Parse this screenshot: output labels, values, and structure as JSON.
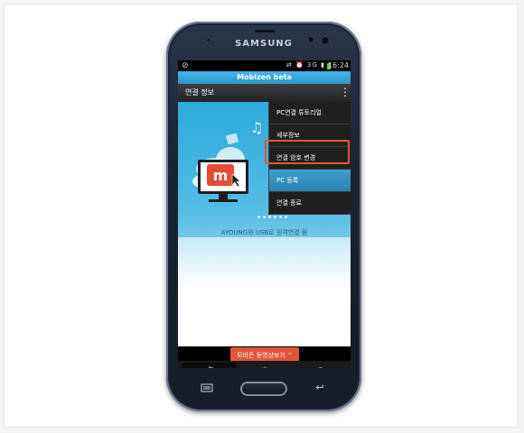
{
  "device": {
    "brand": "SAMSUNG"
  },
  "statusbar": {
    "time": "16:24",
    "network": "3G"
  },
  "app": {
    "title": "Mobizen beta"
  },
  "header": {
    "title": "연결 정보"
  },
  "menu": {
    "items": [
      {
        "label": "PC연결 튜토리얼",
        "selected": false
      },
      {
        "label": "세부정보",
        "selected": false
      },
      {
        "label": "연결 암호 변경",
        "selected": false
      },
      {
        "label": "PC 등록",
        "selected": true
      },
      {
        "label": "연결 종료",
        "selected": false
      }
    ]
  },
  "main": {
    "caption": "AYOUNG와 USB로 원격연결 됨",
    "video_button": "모비즌 동영상보기"
  },
  "bottom_nav": {
    "help_label": "?"
  },
  "colors": {
    "accent": "#2b95cf",
    "highlight": "#e25530",
    "video_button": "#e0553a",
    "logo": "#e34d33"
  }
}
